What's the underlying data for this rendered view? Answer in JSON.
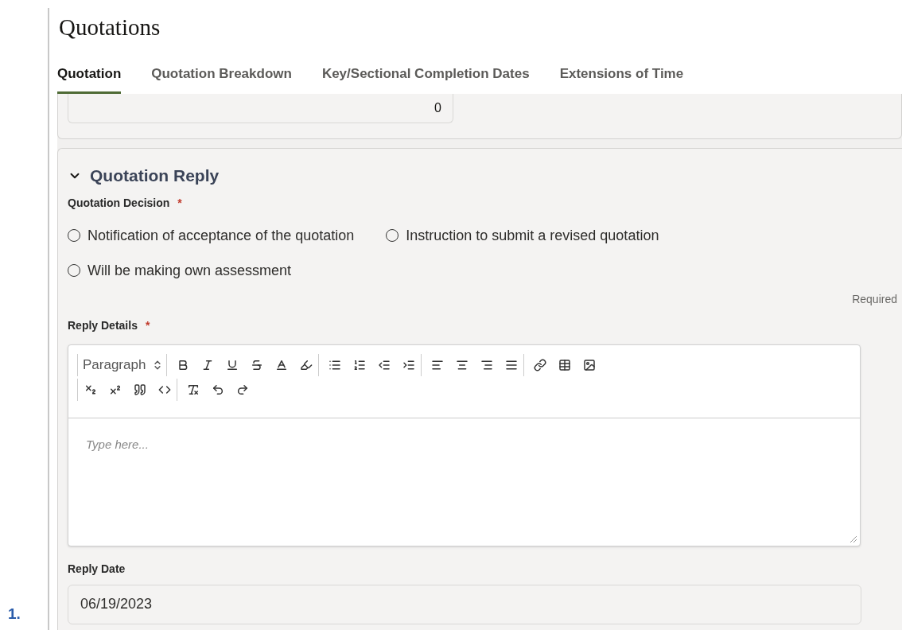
{
  "page_title": "Quotations",
  "tabs": [
    {
      "label": "Quotation",
      "selected": true
    },
    {
      "label": "Quotation Breakdown",
      "selected": false
    },
    {
      "label": "Key/Sectional Completion Dates",
      "selected": false
    },
    {
      "label": "Extensions of Time",
      "selected": false
    }
  ],
  "previous_section": {
    "field_value": "0"
  },
  "reply_section": {
    "title": "Quotation Reply",
    "expanded": true,
    "decision": {
      "label": "Quotation Decision",
      "required_mark": "*",
      "options": [
        {
          "label": "Notification of acceptance of the quotation",
          "selected": false
        },
        {
          "label": "Instruction to submit a revised quotation",
          "selected": false
        },
        {
          "label": "Will be making own assessment",
          "selected": false
        }
      ],
      "hint": "Required"
    },
    "details": {
      "label": "Reply Details",
      "required_mark": "*",
      "block_format": "Paragraph",
      "placeholder": "Type here..."
    },
    "reply_date": {
      "label": "Reply Date",
      "value": "06/19/2023"
    }
  },
  "footnote": "1."
}
